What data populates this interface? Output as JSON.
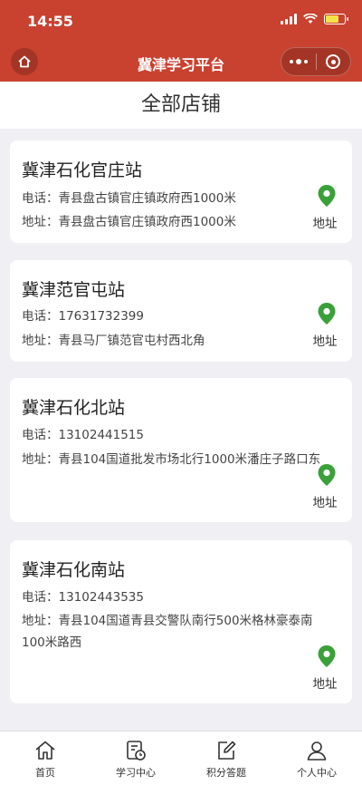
{
  "status_bar": {
    "time": "14:55"
  },
  "header": {
    "title": "冀津学习平台",
    "home_icon": "home-icon",
    "more_icon": "more-dots-icon",
    "close_icon": "close-ring-icon",
    "color": "#c9412f"
  },
  "page": {
    "title": "全部店铺"
  },
  "stores": [
    {
      "name": "冀津石化官庄站",
      "phone_label": "电话：",
      "phone": "青县盘古镇官庄镇政府西1000米",
      "address_label": "地址：",
      "address": "青县盘古镇官庄镇政府西1000米",
      "map_label": "地址"
    },
    {
      "name": "冀津范官屯站",
      "phone_label": "电话：",
      "phone": "17631732399",
      "address_label": "地址：",
      "address": "青县马厂镇范官屯村西北角",
      "map_label": "地址"
    },
    {
      "name": "冀津石化北站",
      "phone_label": "电话：",
      "phone": "13102441515",
      "address_label": "地址：",
      "address": "青县104国道批发市场北行1000米潘庄子路口东",
      "map_label": "地址"
    },
    {
      "name": "冀津石化南站",
      "phone_label": "电话：",
      "phone": "13102443535",
      "address_label": "地址：",
      "address": "青县104国道青县交警队南行500米格林豪泰南100米路西",
      "map_label": "地址"
    }
  ],
  "tabbar": [
    {
      "label": "首页",
      "icon": "home-outline-icon"
    },
    {
      "label": "学习中心",
      "icon": "study-clock-icon"
    },
    {
      "label": "积分答题",
      "icon": "edit-icon"
    },
    {
      "label": "个人中心",
      "icon": "user-icon"
    }
  ],
  "colors": {
    "pin": "#3aa13a",
    "card_bg": "#ffffff",
    "page_bg": "#efeff4"
  }
}
